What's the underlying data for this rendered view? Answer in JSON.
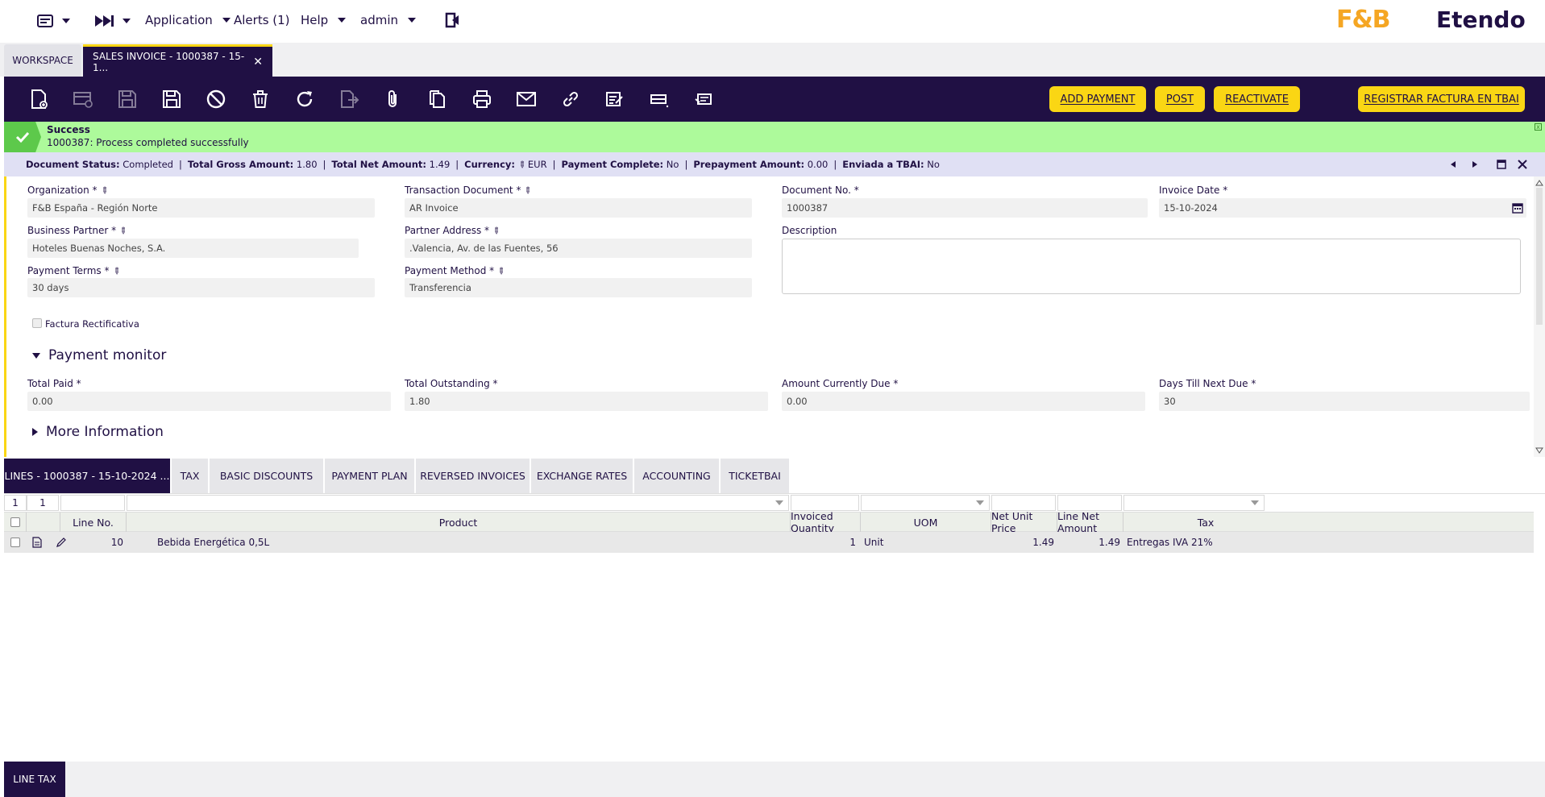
{
  "topnav": {
    "application": "Application",
    "alerts": "Alerts (1)",
    "help": "Help",
    "user": "admin"
  },
  "logos": {
    "fb": "F&B",
    "etendo": "Etendo"
  },
  "window_tabs": {
    "workspace": "WORKSPACE",
    "active": "SALES INVOICE - 1000387 - 15-1..."
  },
  "toolbar": {
    "icons": [
      "new-document-icon",
      "new-row-icon",
      "save-icon",
      "save-close-icon",
      "cancel-icon",
      "delete-icon",
      "refresh-icon",
      "export-icon",
      "attachment-icon",
      "clone-icon",
      "print-icon",
      "email-icon",
      "link-icon",
      "audit-icon",
      "grid-view-icon",
      "tree-icon"
    ],
    "add_payment": "ADD PAYMENT",
    "post": "POST",
    "reactivate": "REACTIVATE",
    "registrar": "REGISTRAR FACTURA EN TBAI"
  },
  "message": {
    "title": "Success",
    "text": "1000387: Process completed successfully"
  },
  "status": {
    "doc_status_label": "Document Status:",
    "doc_status": "Completed",
    "gross_label": "Total Gross Amount:",
    "gross": "1.80",
    "net_label": "Total Net Amount:",
    "net": "1.49",
    "currency_label": "Currency:",
    "currency": "EUR",
    "payment_complete_label": "Payment Complete:",
    "payment_complete": "No",
    "prepayment_label": "Prepayment Amount:",
    "prepayment": "0.00",
    "tbai_label": "Enviada a TBAI:",
    "tbai": "No"
  },
  "form": {
    "organization_label": "Organization *",
    "organization": "F&B España - Región Norte",
    "transaction_doc_label": "Transaction Document *",
    "transaction_doc": "AR Invoice",
    "document_no_label": "Document No. *",
    "document_no": "1000387",
    "invoice_date_label": "Invoice Date *",
    "invoice_date": "15-10-2024",
    "business_partner_label": "Business Partner *",
    "business_partner": "Hoteles Buenas Noches, S.A.",
    "partner_address_label": "Partner Address *",
    "partner_address": ".Valencia, Av. de las Fuentes, 56",
    "description_label": "Description",
    "description": "",
    "payment_terms_label": "Payment Terms *",
    "payment_terms": "30 days",
    "payment_method_label": "Payment Method *",
    "payment_method": "Transferencia",
    "factura_rect_label": "Factura Rectificativa"
  },
  "payment_monitor": {
    "title": "Payment monitor",
    "total_paid_label": "Total Paid *",
    "total_paid": "0.00",
    "total_outstanding_label": "Total Outstanding *",
    "total_outstanding": "1.80",
    "amount_due_label": "Amount Currently Due *",
    "amount_due": "0.00",
    "days_next_due_label": "Days Till Next Due *",
    "days_next_due": "30"
  },
  "more_info": {
    "title": "More Information"
  },
  "subtabs": [
    "LINES - 1000387 - 15-10-2024 ...",
    "TAX",
    "BASIC DISCOUNTS",
    "PAYMENT PLAN",
    "REVERSED INVOICES",
    "EXCHANGE RATES",
    "ACCOUNTING",
    "TICKETBAI"
  ],
  "grid": {
    "counter_a": "1",
    "counter_b": "1",
    "headers": [
      "Line No.",
      "Product",
      "Invoiced Quantity",
      "UOM",
      "Net Unit Price",
      "Line Net Amount",
      "Tax"
    ],
    "rows": [
      {
        "line_no": "10",
        "product": "Bebida Energética 0,5L",
        "qty": "1",
        "uom": "Unit",
        "net_unit_price": "1.49",
        "line_net_amount": "1.49",
        "tax": "Entregas IVA 21%"
      }
    ]
  },
  "bottom_tab": "LINE TAX"
}
